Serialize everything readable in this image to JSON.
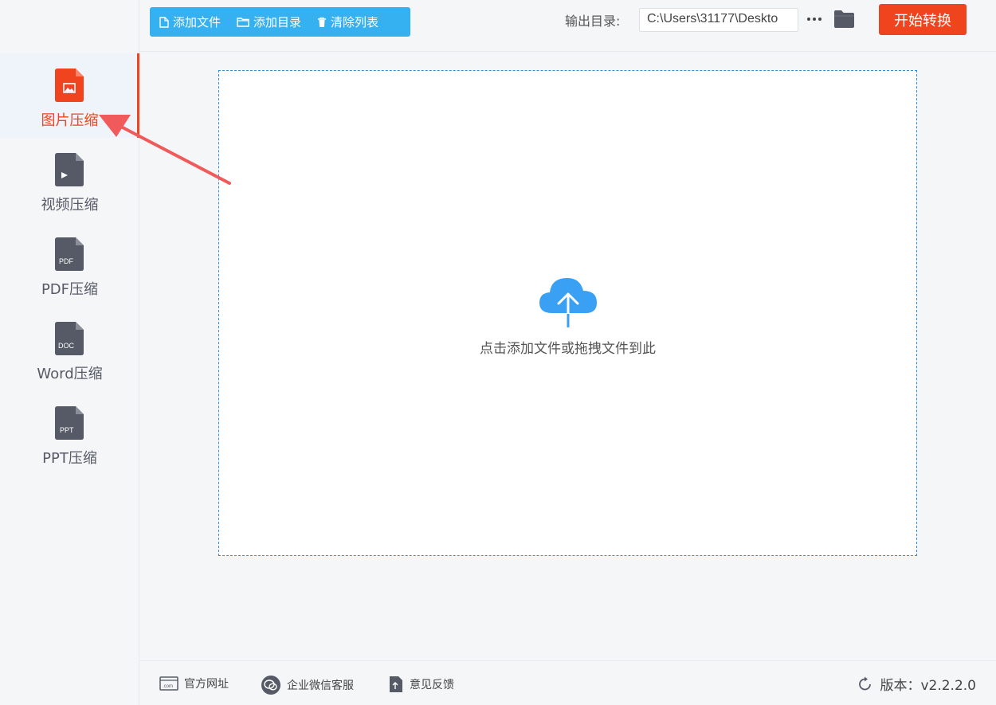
{
  "toolbar": {
    "add_file": "添加文件",
    "add_folder": "添加目录",
    "clear_list": "清除列表"
  },
  "output": {
    "label": "输出目录:",
    "path": "C:\\Users\\31177\\Deskto"
  },
  "start_button": "开始转换",
  "sidebar": {
    "items": [
      {
        "label": "图片压缩",
        "icon": "image-file-icon",
        "active": true
      },
      {
        "label": "视频压缩",
        "icon": "video-file-icon",
        "active": false
      },
      {
        "label": "PDF压缩",
        "icon": "pdf-file-icon",
        "badge": "PDF",
        "active": false
      },
      {
        "label": "Word压缩",
        "icon": "doc-file-icon",
        "badge": "DOC",
        "active": false
      },
      {
        "label": "PPT压缩",
        "icon": "ppt-file-icon",
        "badge": "PPT",
        "active": false
      }
    ]
  },
  "dropzone": {
    "hint": "点击添加文件或拖拽文件到此"
  },
  "footer": {
    "website": "官方网址",
    "wechat": "企业微信客服",
    "feedback": "意见反馈",
    "version": "版本：v2.2.2.0"
  },
  "colors": {
    "accent": "#f0441f",
    "toolbar": "#35b0f0",
    "icon": "#555a66",
    "cloud": "#3aa0f3"
  }
}
